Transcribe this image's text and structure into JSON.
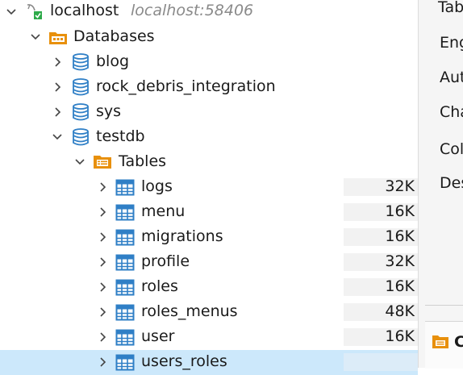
{
  "tree": {
    "server": {
      "label": "localhost",
      "hint": "localhost:58406"
    },
    "databases_label": "Databases",
    "databases": [
      "blog",
      "rock_debris_integration",
      "sys",
      "testdb"
    ],
    "tables_label": "Tables",
    "tables": [
      {
        "name": "logs",
        "size": "32K"
      },
      {
        "name": "menu",
        "size": "16K"
      },
      {
        "name": "migrations",
        "size": "16K"
      },
      {
        "name": "profile",
        "size": "32K"
      },
      {
        "name": "roles",
        "size": "16K"
      },
      {
        "name": "roles_menus",
        "size": "48K"
      },
      {
        "name": "user",
        "size": "16K"
      },
      {
        "name": "users_roles",
        "size": ""
      }
    ],
    "selected_table": "users_roles"
  },
  "properties_panel": {
    "labels": [
      "Tab",
      "Eng",
      "Aut",
      "Cha",
      "Col",
      "Des"
    ],
    "bottom_tab_label": "C"
  },
  "colors": {
    "selection": "#cce8fb",
    "folder": "#e8900c",
    "database": "#2f7fc6",
    "table": "#2f7fc6",
    "connected": "#2eaa4a"
  }
}
